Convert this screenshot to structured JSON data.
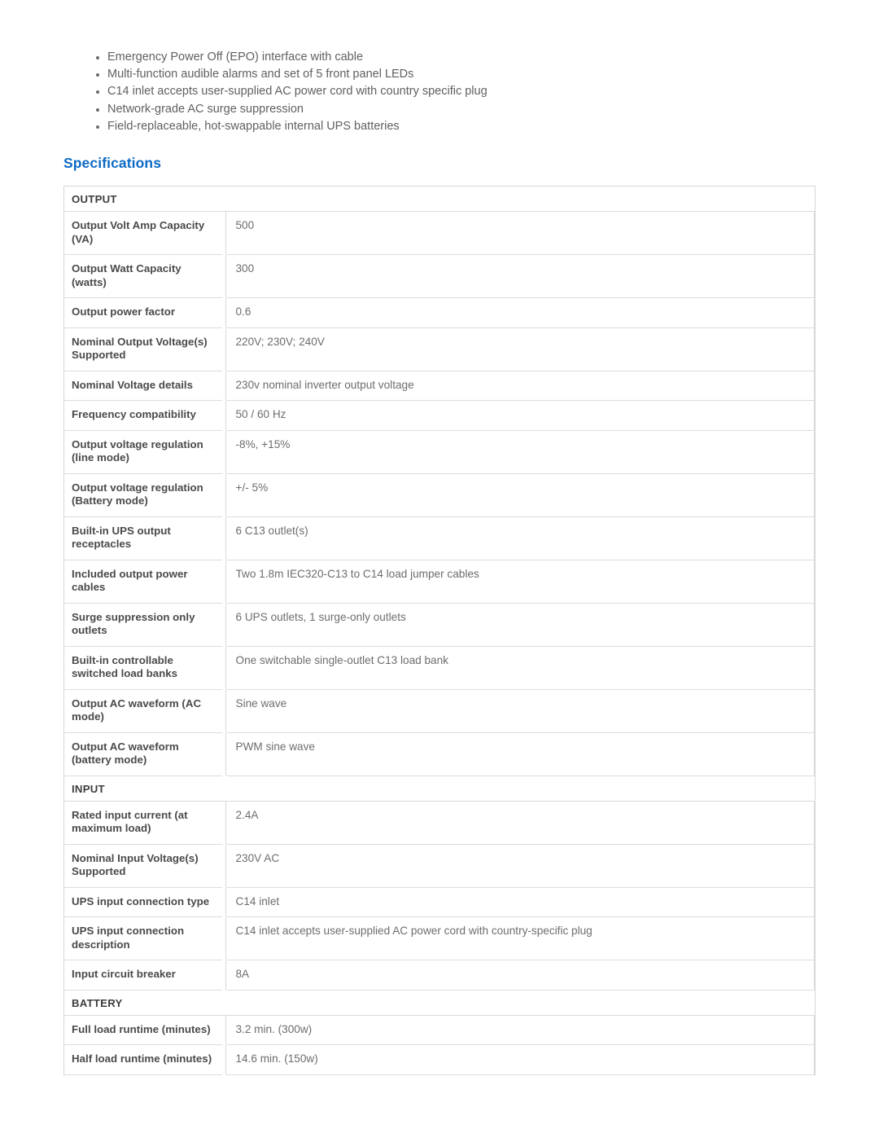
{
  "features": [
    "Emergency Power Off (EPO) interface with cable",
    "Multi-function audible alarms and set of 5 front panel LEDs",
    "C14 inlet accepts user-supplied AC power cord with country specific plug",
    "Network-grade AC surge suppression",
    "Field-replaceable, hot-swappable internal UPS batteries"
  ],
  "section": {
    "heading": "Specifications",
    "heading_color": "#0d6ac4"
  },
  "spec_table": {
    "groups": [
      {
        "name": "OUTPUT",
        "rows": [
          {
            "label": "Output Volt Amp Capacity (VA)",
            "value": "500"
          },
          {
            "label": "Output Watt Capacity (watts)",
            "value": "300"
          },
          {
            "label": "Output power factor",
            "value": "0.6"
          },
          {
            "label": "Nominal Output Voltage(s) Supported",
            "value": "220V; 230V; 240V"
          },
          {
            "label": "Nominal Voltage details",
            "value": "230v nominal inverter output voltage"
          },
          {
            "label": "Frequency compatibility",
            "value": "50 / 60 Hz"
          },
          {
            "label": "Output voltage regulation (line mode)",
            "value": "-8%, +15%"
          },
          {
            "label": "Output voltage regulation (Battery mode)",
            "value": "+/- 5%"
          },
          {
            "label": "Built-in UPS output receptacles",
            "value": "6 C13 outlet(s)"
          },
          {
            "label": "Included output power cables",
            "value": "Two 1.8m IEC320-C13 to C14 load jumper cables"
          },
          {
            "label": "Surge suppression only outlets",
            "value": "6 UPS outlets, 1 surge-only outlets"
          },
          {
            "label": "Built-in controllable switched load banks",
            "value": "One switchable single-outlet C13 load bank"
          },
          {
            "label": "Output AC waveform (AC mode)",
            "value": "Sine wave"
          },
          {
            "label": "Output AC waveform (battery mode)",
            "value": "PWM sine wave"
          }
        ]
      },
      {
        "name": "INPUT",
        "rows": [
          {
            "label": "Rated input current (at maximum load)",
            "value": "2.4A"
          },
          {
            "label": "Nominal Input Voltage(s) Supported",
            "value": "230V AC"
          },
          {
            "label": "UPS input connection type",
            "value": "C14 inlet"
          },
          {
            "label": "UPS input connection description",
            "value": "C14 inlet accepts user-supplied AC power cord with country-specific plug"
          },
          {
            "label": "Input circuit breaker",
            "value": "8A"
          }
        ]
      },
      {
        "name": "BATTERY",
        "rows": [
          {
            "label": "Full load runtime (minutes)",
            "value": "3.2 min. (300w)"
          },
          {
            "label": "Half load runtime (minutes)",
            "value": "14.6 min. (150w)"
          }
        ]
      }
    ]
  }
}
